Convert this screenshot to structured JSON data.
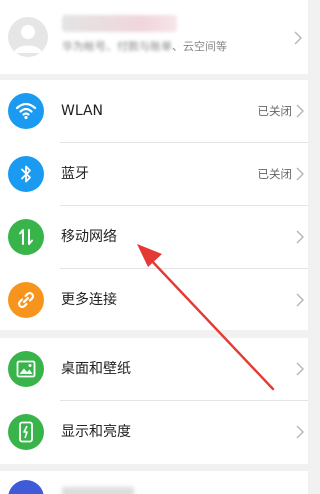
{
  "account": {
    "subtitle_prefix": "华为帐号、",
    "subtitle_suffix": "、云空间等",
    "subtitle_blurred_text": "付款与账单"
  },
  "network": {
    "wlan": {
      "label": "WLAN",
      "status": "已关闭",
      "icon": "wifi-icon",
      "color": "#1a9af0"
    },
    "bluetooth": {
      "label": "蓝牙",
      "status": "已关闭",
      "icon": "bluetooth-icon",
      "color": "#1a9af0"
    },
    "mobile": {
      "label": "移动网络",
      "icon": "mobile-data-icon",
      "color": "#38b44a"
    },
    "more": {
      "label": "更多连接",
      "icon": "link-icon",
      "color": "#f7941d"
    }
  },
  "display": {
    "wallpaper": {
      "label": "桌面和壁纸",
      "icon": "wallpaper-icon",
      "color": "#38b44a"
    },
    "brightness": {
      "label": "显示和亮度",
      "icon": "display-icon",
      "color": "#38b44a"
    }
  },
  "annotation": {
    "color": "#e53935"
  }
}
